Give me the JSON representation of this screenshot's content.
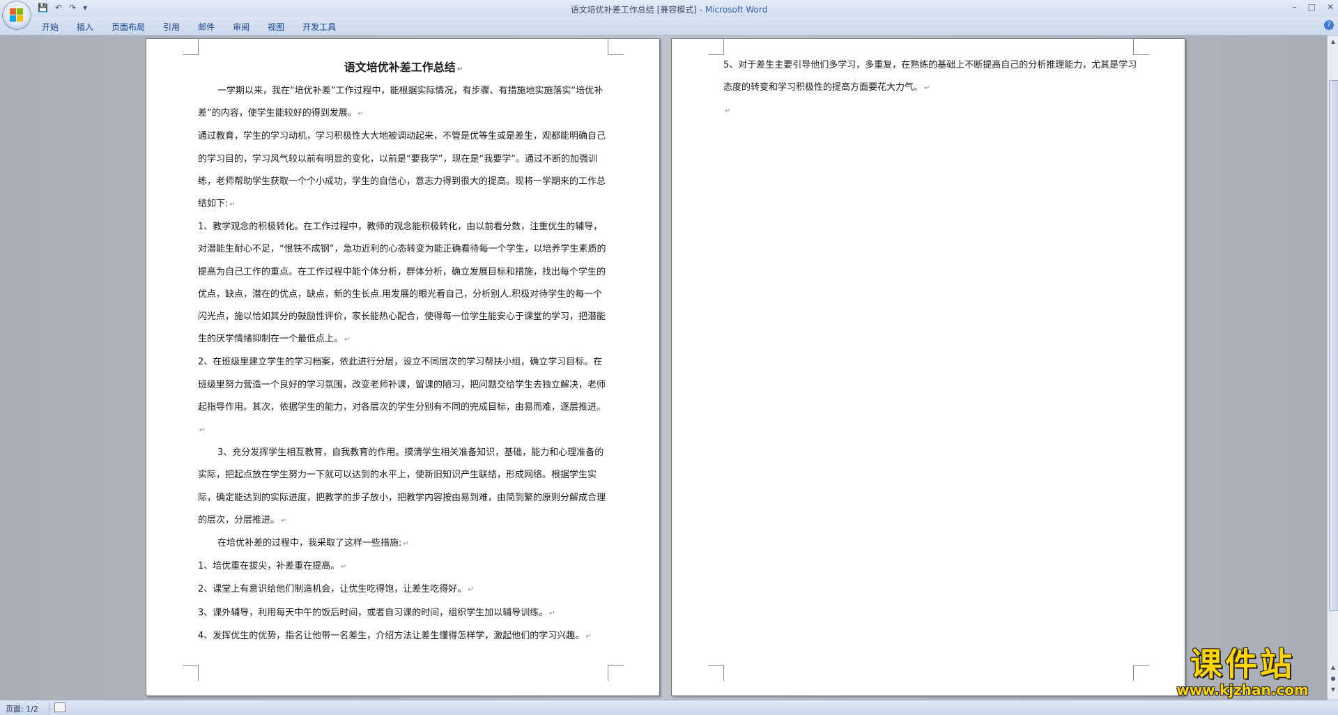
{
  "window": {
    "title_doc": "语文培优补差工作总结 [兼容模式] - ",
    "title_app": "Microsoft Word",
    "controls": [
      "–",
      "□",
      "✕"
    ]
  },
  "ribbon": {
    "tabs": [
      "开始",
      "插入",
      "页面布局",
      "引用",
      "邮件",
      "审阅",
      "视图",
      "开发工具"
    ]
  },
  "document": {
    "title": "语文培优补差工作总结",
    "page1_paragraphs": [
      {
        "text": "一学期以来，我在“培优补差”工作过程中，能根据实际情况，有步骤、有措施地实施落实“培优补差”的内容，使学生能较好的得到发展。",
        "indent": true
      },
      {
        "text": "通过教育，学生的学习动机，学习积极性大大地被调动起来，不管是优等生或是差生，观都能明确自己的学习目的，学习风气较以前有明显的变化，以前是“要我学”，现在是“我要学”。通过不断的加强训练，老师帮助学生获取一个个小成功，学生的自信心，意志力得到很大的提高。现将一学期来的工作总结如下:",
        "indent": false
      },
      {
        "text": "1、教学观念的积极转化。在工作过程中，教师的观念能积极转化，由以前看分数，注重优生的辅导，对潜能生耐心不足，“恨铁不成钢”，急功近利的心态转变为能正确看待每一个学生，以培养学生素质的提高为自己工作的重点。在工作过程中能个体分析，群体分析，确立发展目标和措施，找出每个学生的优点，缺点，潜在的优点，缺点，新的生长点.用发展的眼光看自己，分析别人.积极对待学生的每一个闪光点，施以恰如其分的鼓励性评价，家长能热心配合，使得每一位学生能安心于课堂的学习，把潜能生的厌学情绪抑制在一个最低点上。",
        "indent": false
      },
      {
        "text": "2、在班级里建立学生的学习档案，依此进行分层，设立不同层次的学习帮扶小组，确立学习目标。在班级里努力营造一个良好的学习氛围，改变老师补课，留课的陋习，把问题交给学生去独立解决，老师起指导作用。其次，依据学生的能力，对各层次的学生分别有不同的完成目标，由易而难，逐层推进。",
        "indent": false
      },
      {
        "text": "3、充分发挥学生相互教育，自我教育的作用。摸清学生相关准备知识，基础，能力和心理准备的实际，把起点放在学生努力一下就可以达到的水平上，使新旧知识产生联结，形成网络。根据学生实际，确定能达到的实际进度，把教学的步子放小，把教学内容按由易到难，由简到繁的原则分解成合理的层次，分层推进。",
        "indent": true
      },
      {
        "text": "在培优补差的过程中，我采取了这样一些措施:",
        "indent": true
      },
      {
        "text": "1、培优重在拔尖，补差重在提高。",
        "indent": false
      },
      {
        "text": "2、课堂上有意识给他们制造机会，让优生吃得饱，让差生吃得好。",
        "indent": false
      },
      {
        "text": "3、课外辅导，利用每天中午的饭后时间，或者自习课的时间，组织学生加以辅导训练。",
        "indent": false
      },
      {
        "text": "4、发挥优生的优势，指名让他带一名差生，介绍方法让差生懂得怎样学，激起他们的学习兴趣。",
        "indent": false
      }
    ],
    "page2_paragraphs": [
      {
        "text": "5、对于差生主要引导他们多学习，多重复，在熟练的基础上不断提高自己的分析推理能力，尤其是学习态度的转变和学习积极性的提高方面要花大力气。",
        "indent": false
      },
      {
        "text": "",
        "indent": false
      }
    ],
    "paragraph_mark": "↵"
  },
  "statusbar": {
    "page_info": "页面: 1/2"
  },
  "watermark": {
    "brand": "课件站",
    "url": "www.kjzhan.com"
  },
  "colors": {
    "ribbon_text": "#15428b",
    "app_title": "#3660a8",
    "watermark": "#ffd400"
  }
}
